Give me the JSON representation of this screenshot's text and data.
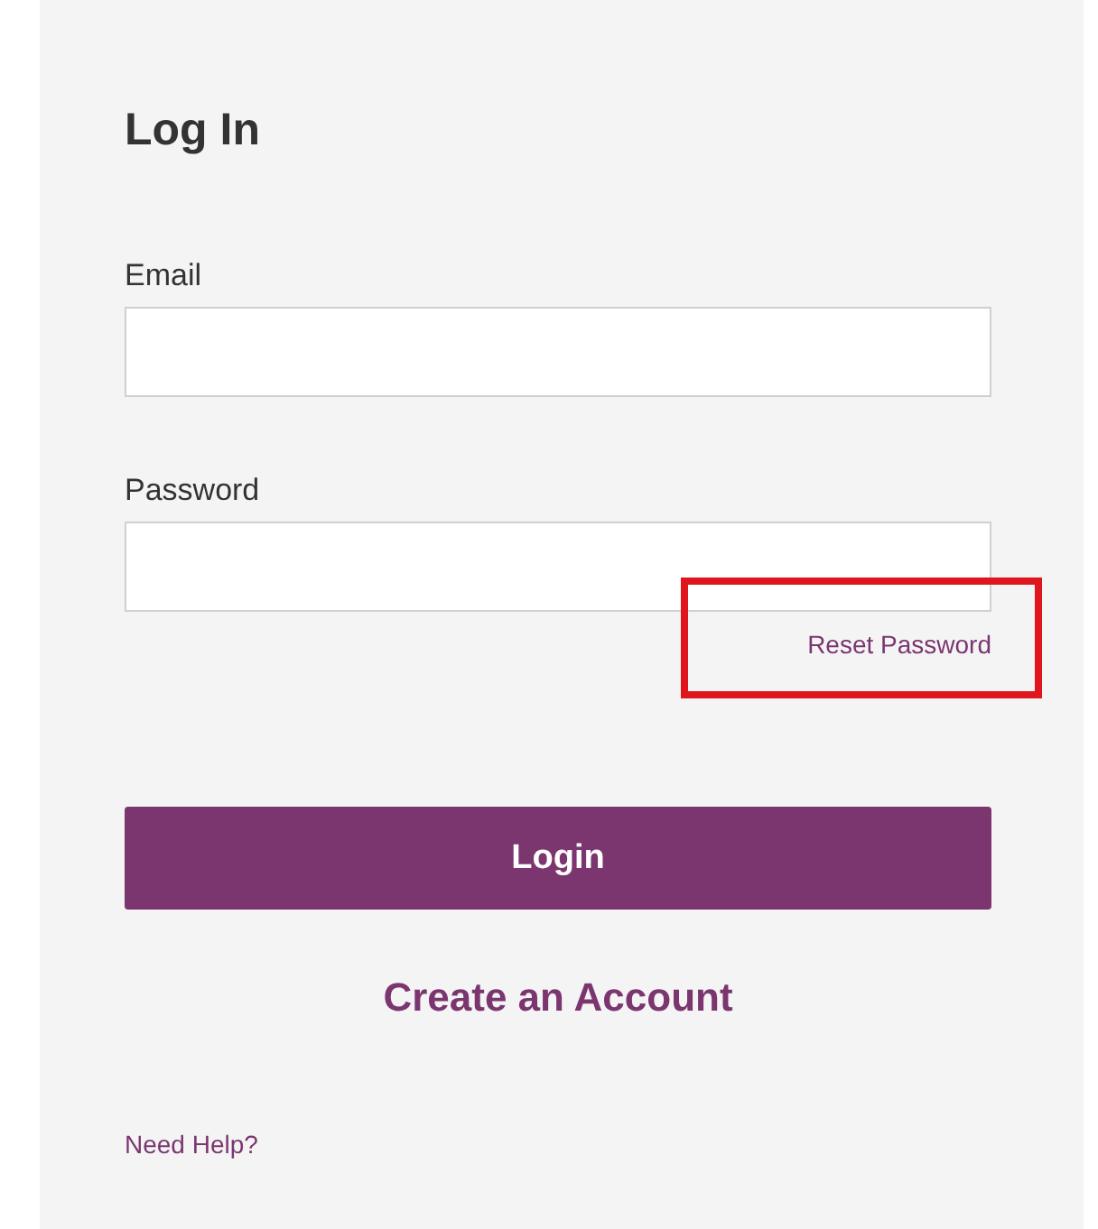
{
  "title": "Log In",
  "fields": [
    {
      "label": "Email"
    },
    {
      "label": "Password"
    }
  ],
  "reset_link": {
    "text": "Reset Password",
    "highlighted": true
  },
  "login_button": "Login",
  "create_account_link": "Create an Account",
  "help_link": "Need Help?"
}
